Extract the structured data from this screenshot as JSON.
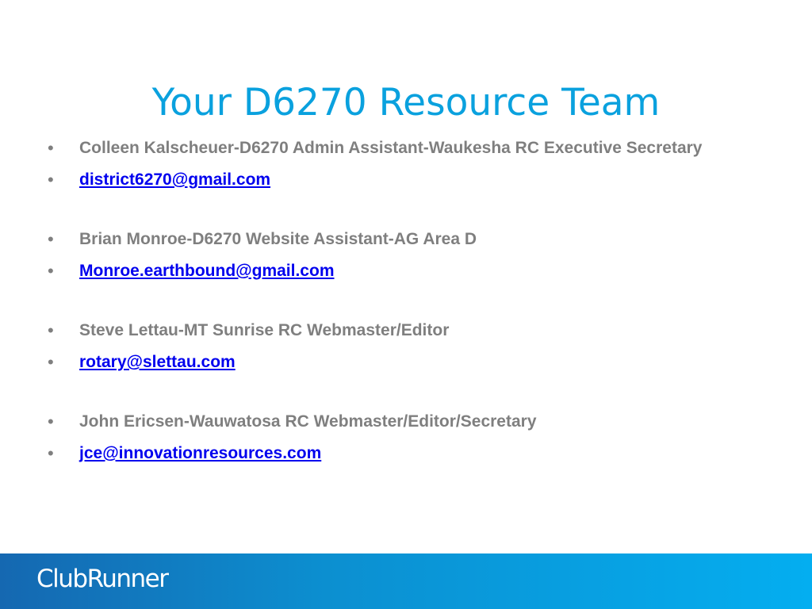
{
  "slide": {
    "title": "Your D6270 Resource Team"
  },
  "contacts": [
    {
      "description": "Colleen  Kalscheuer-D6270 Admin Assistant-Waukesha RC Executive Secretary",
      "email": "district6270@gmail.com"
    },
    {
      "description": "Brian Monroe-D6270 Website Assistant-AG Area D",
      "email": "Monroe.earthbound@gmail.com"
    },
    {
      "description": "Steve Lettau-MT Sunrise RC Webmaster/Editor",
      "email": "rotary@slettau.com"
    },
    {
      "description": "John Ericsen-Wauwatosa RC Webmaster/Editor/Secretary",
      "email": "jce@innovationresources.com"
    }
  ],
  "footer": {
    "logo_text": "ClubRunner",
    "bar_color_start": "#1568b1",
    "bar_color_end": "#04aef0"
  },
  "colors": {
    "title": "#0aa1de",
    "body_text": "#7f7f7f",
    "link": "#0000ee"
  }
}
